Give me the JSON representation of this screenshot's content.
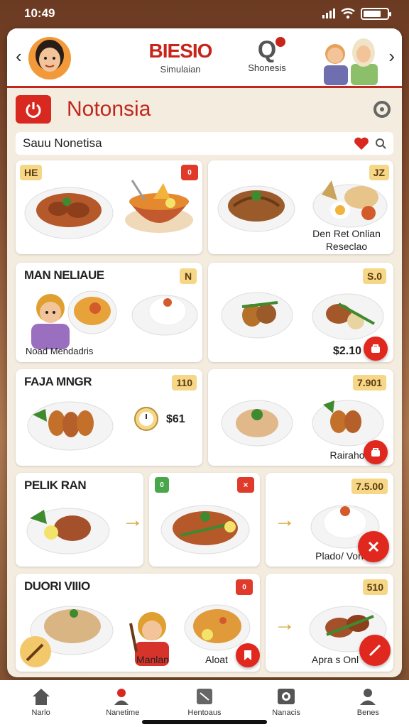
{
  "status": {
    "time": "10:49"
  },
  "header": {
    "brand_title": "BIESIO",
    "brand_subtitle": "Simulaian",
    "secondary_label": "Shonesis",
    "back_glyph": "‹",
    "forward_glyph": "›"
  },
  "app": {
    "title": "Notonsia"
  },
  "search": {
    "value": "Sauu Nonetisa"
  },
  "cards": [
    {
      "badge": "HE"
    },
    {
      "badge2": "0"
    },
    {
      "badge": "JZ",
      "caption": "Den Ret Onlian Reseclao"
    },
    {
      "title": "MAN NELIAUE",
      "badge": "N",
      "caption": "Noad Mendadris"
    },
    {
      "badge": "S.0",
      "price": "$2.10"
    },
    {
      "title": "FAJA MNGR",
      "badge": "110",
      "price": "$61"
    },
    {
      "badge": "7.901",
      "caption": "Rairaho"
    },
    {
      "title": "PELIK RAN"
    },
    {
      "badge": "0",
      "badge2": "×"
    },
    {
      "badge": "7.5.00",
      "caption": "Plado/ Vori"
    },
    {
      "title": "DUORI VIIIO",
      "badge": "0",
      "caption": "Manlan",
      "caption2": "Aloat"
    },
    {
      "badge": "510",
      "caption": "Apra s Onl"
    }
  ],
  "tabs": [
    {
      "label": "Narlo"
    },
    {
      "label": "Nanetime"
    },
    {
      "label": "Hentoaus"
    },
    {
      "label": "Nanacis"
    },
    {
      "label": "Benes"
    }
  ],
  "colors": {
    "accent": "#c7251b",
    "badge_gold": "#f5d787",
    "background": "#f4ecdf"
  }
}
